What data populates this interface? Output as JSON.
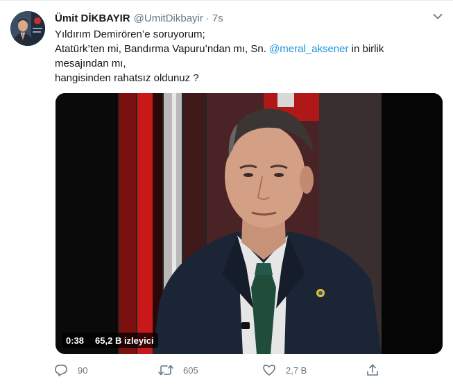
{
  "tweet": {
    "author_name": "Ümit DİKBAYIR",
    "author_handle": "@UmitDikbayir",
    "separator": "·",
    "time": "7s",
    "text_lines": {
      "line1": "Yıldırım Demirören’e soruyorum;",
      "line2_pre": "Atatürk’ten mi, Bandırma Vapuru’ndan mı, Sn. ",
      "line2_mention": "@meral_aksener",
      "line2_post": " in birlik",
      "line3": "mesajından mı,",
      "line4": "hangisinden rahatsız oldunuz ?"
    },
    "video": {
      "duration": "0:38",
      "views": "65,2 B izleyici"
    },
    "actions": {
      "reply_count": "90",
      "retweet_count": "605",
      "like_count": "2,7 B"
    },
    "icons": {
      "menu": "chevron-down-icon",
      "reply": "reply-icon",
      "retweet": "retweet-icon",
      "like": "heart-icon",
      "share": "share-icon"
    },
    "colors": {
      "mention": "#1b95e0",
      "secondary_text": "#657786",
      "primary_text": "#14171a"
    }
  }
}
